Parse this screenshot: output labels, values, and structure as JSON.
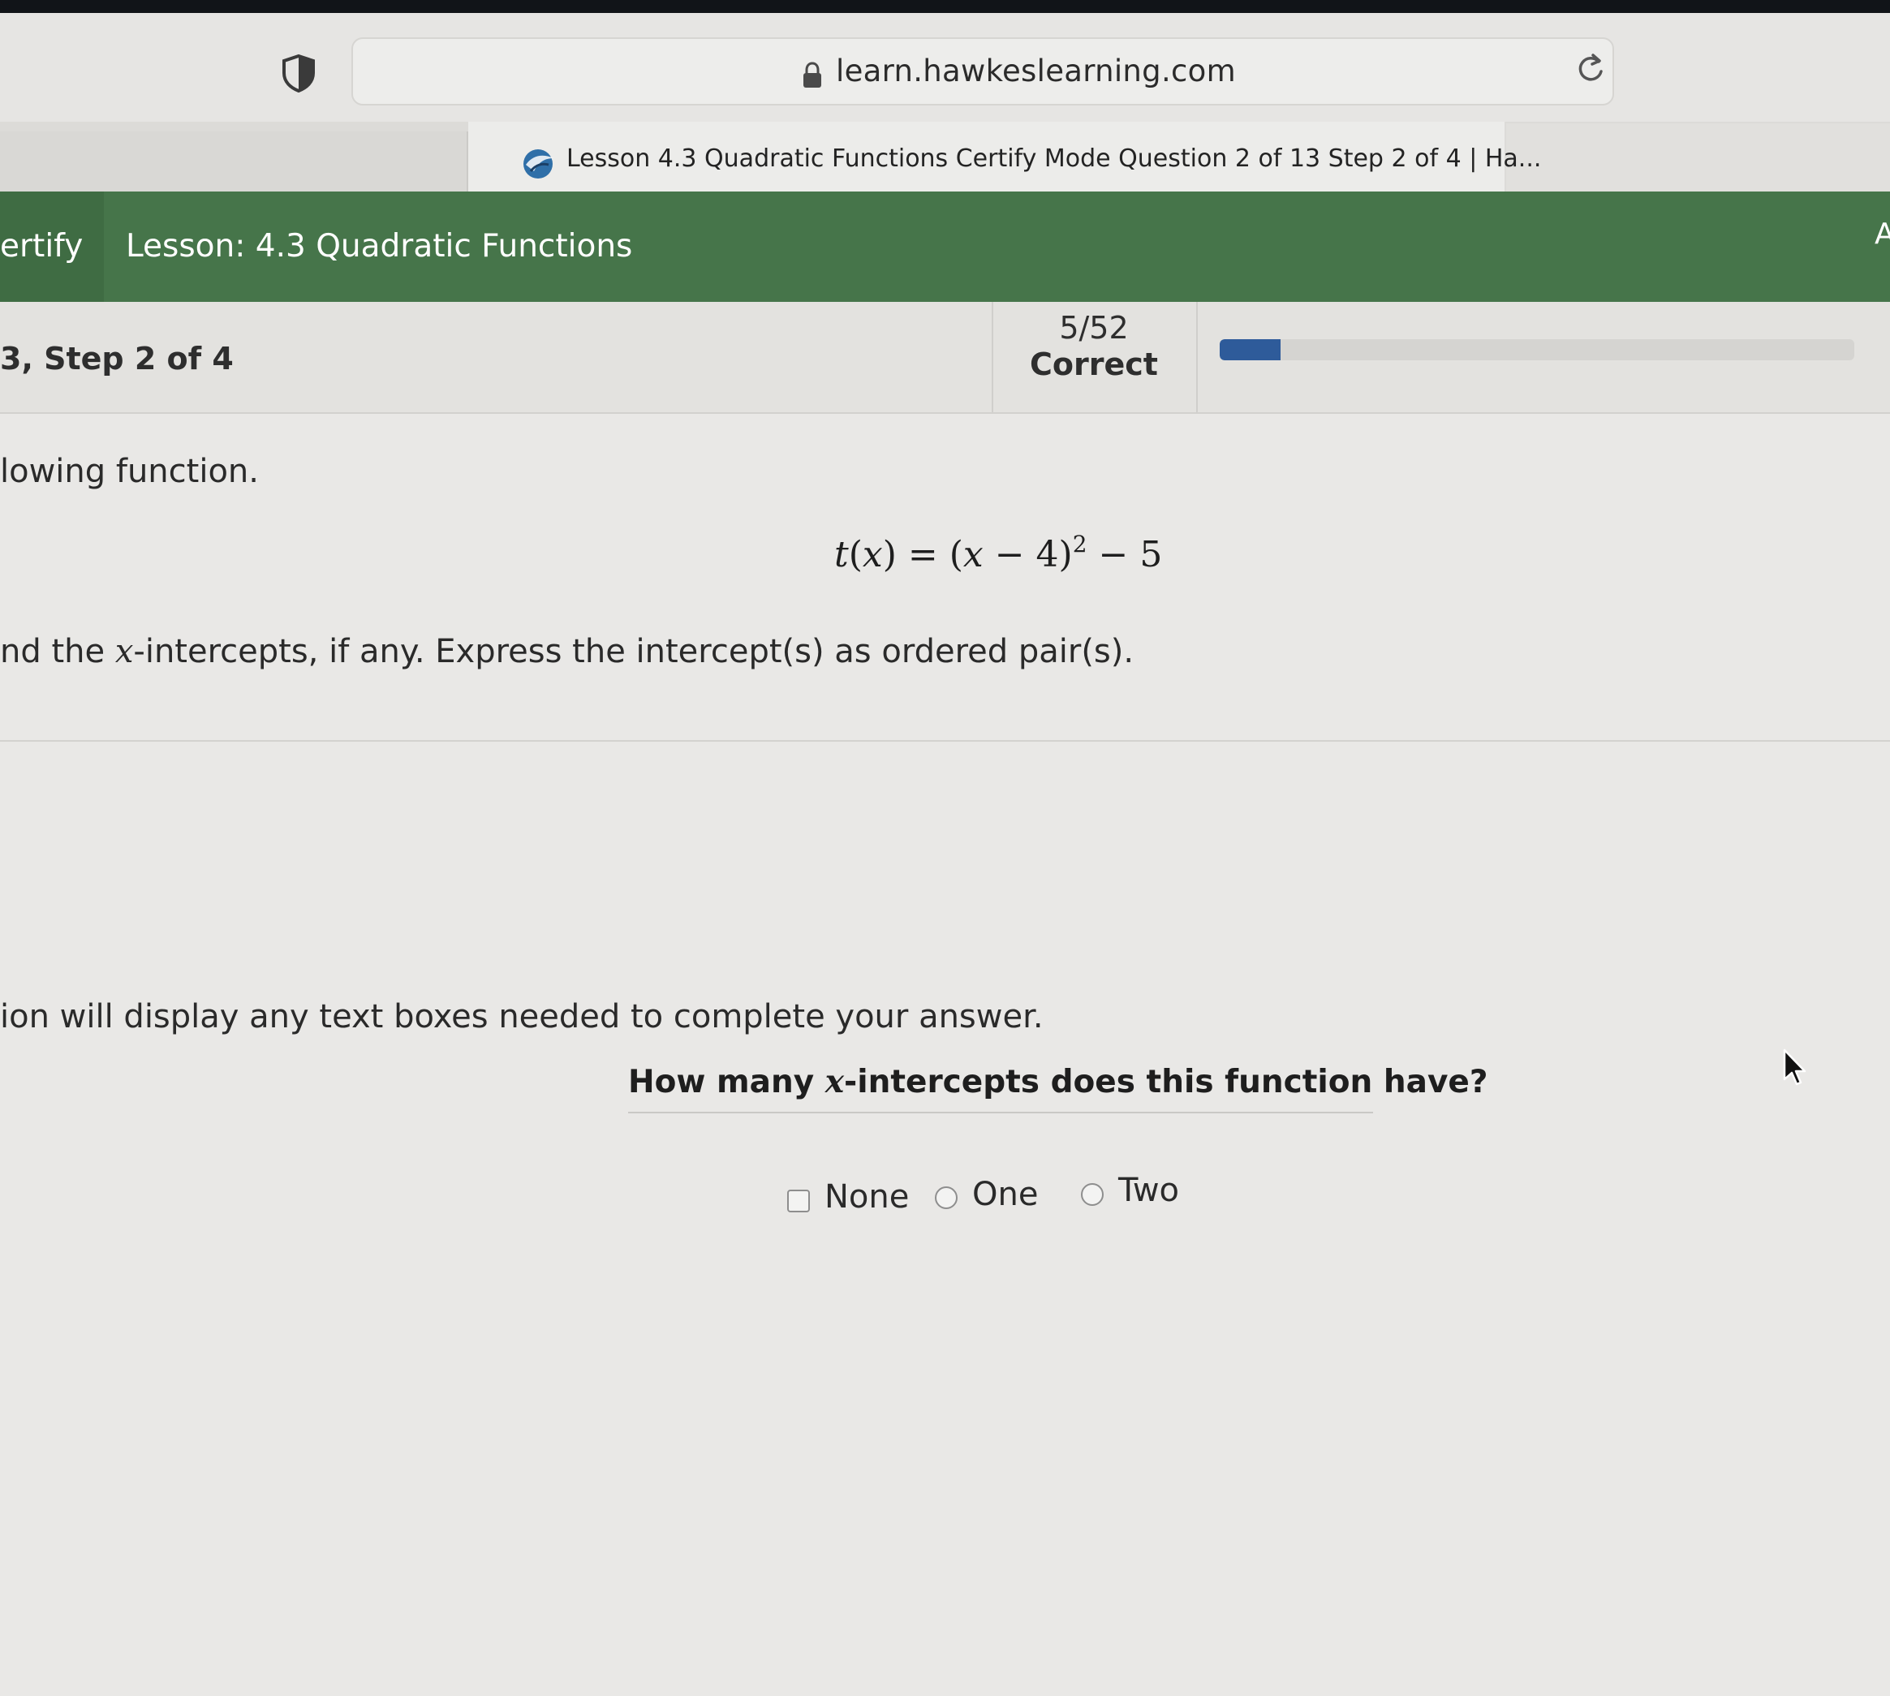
{
  "browser": {
    "url": "learn.hawkeslearning.com",
    "tab_title": "Lesson 4.3 Quadratic Functions Certify Mode Question 2 of 13 Step 2 of 4 | Ha..."
  },
  "header": {
    "mode_label": "ertify",
    "lesson_title": "Lesson: 4.3 Quadratic Functions",
    "right_edge_char": "A",
    "background_color": "#46754a"
  },
  "status": {
    "step_label": "3, Step 2 of 4",
    "score": "5/52",
    "score_label": "Correct",
    "progress_fraction": 0.0962,
    "progress_color": "#2e5b9a"
  },
  "question": {
    "instruction": "lowing function.",
    "task_prefix": "nd the ",
    "task_var": "x",
    "task_suffix": "-intercepts, if any. Express the intercept(s) as ordered pair(s).",
    "hint": "ion will display any text boxes needed to complete your answer.",
    "subquestion_prefix": "How many ",
    "subquestion_var": "x",
    "subquestion_suffix": "-intercepts does this function have?",
    "equation": {
      "fn": "t",
      "var": "x",
      "lhs_open": "(",
      "lhs_close": ")",
      "equals": " = ",
      "base_open": "(",
      "base_minus": " − 4)",
      "exponent": "2",
      "tail": " − 5"
    },
    "options": [
      {
        "label": "None"
      },
      {
        "label": "One"
      },
      {
        "label": "Two"
      }
    ]
  }
}
